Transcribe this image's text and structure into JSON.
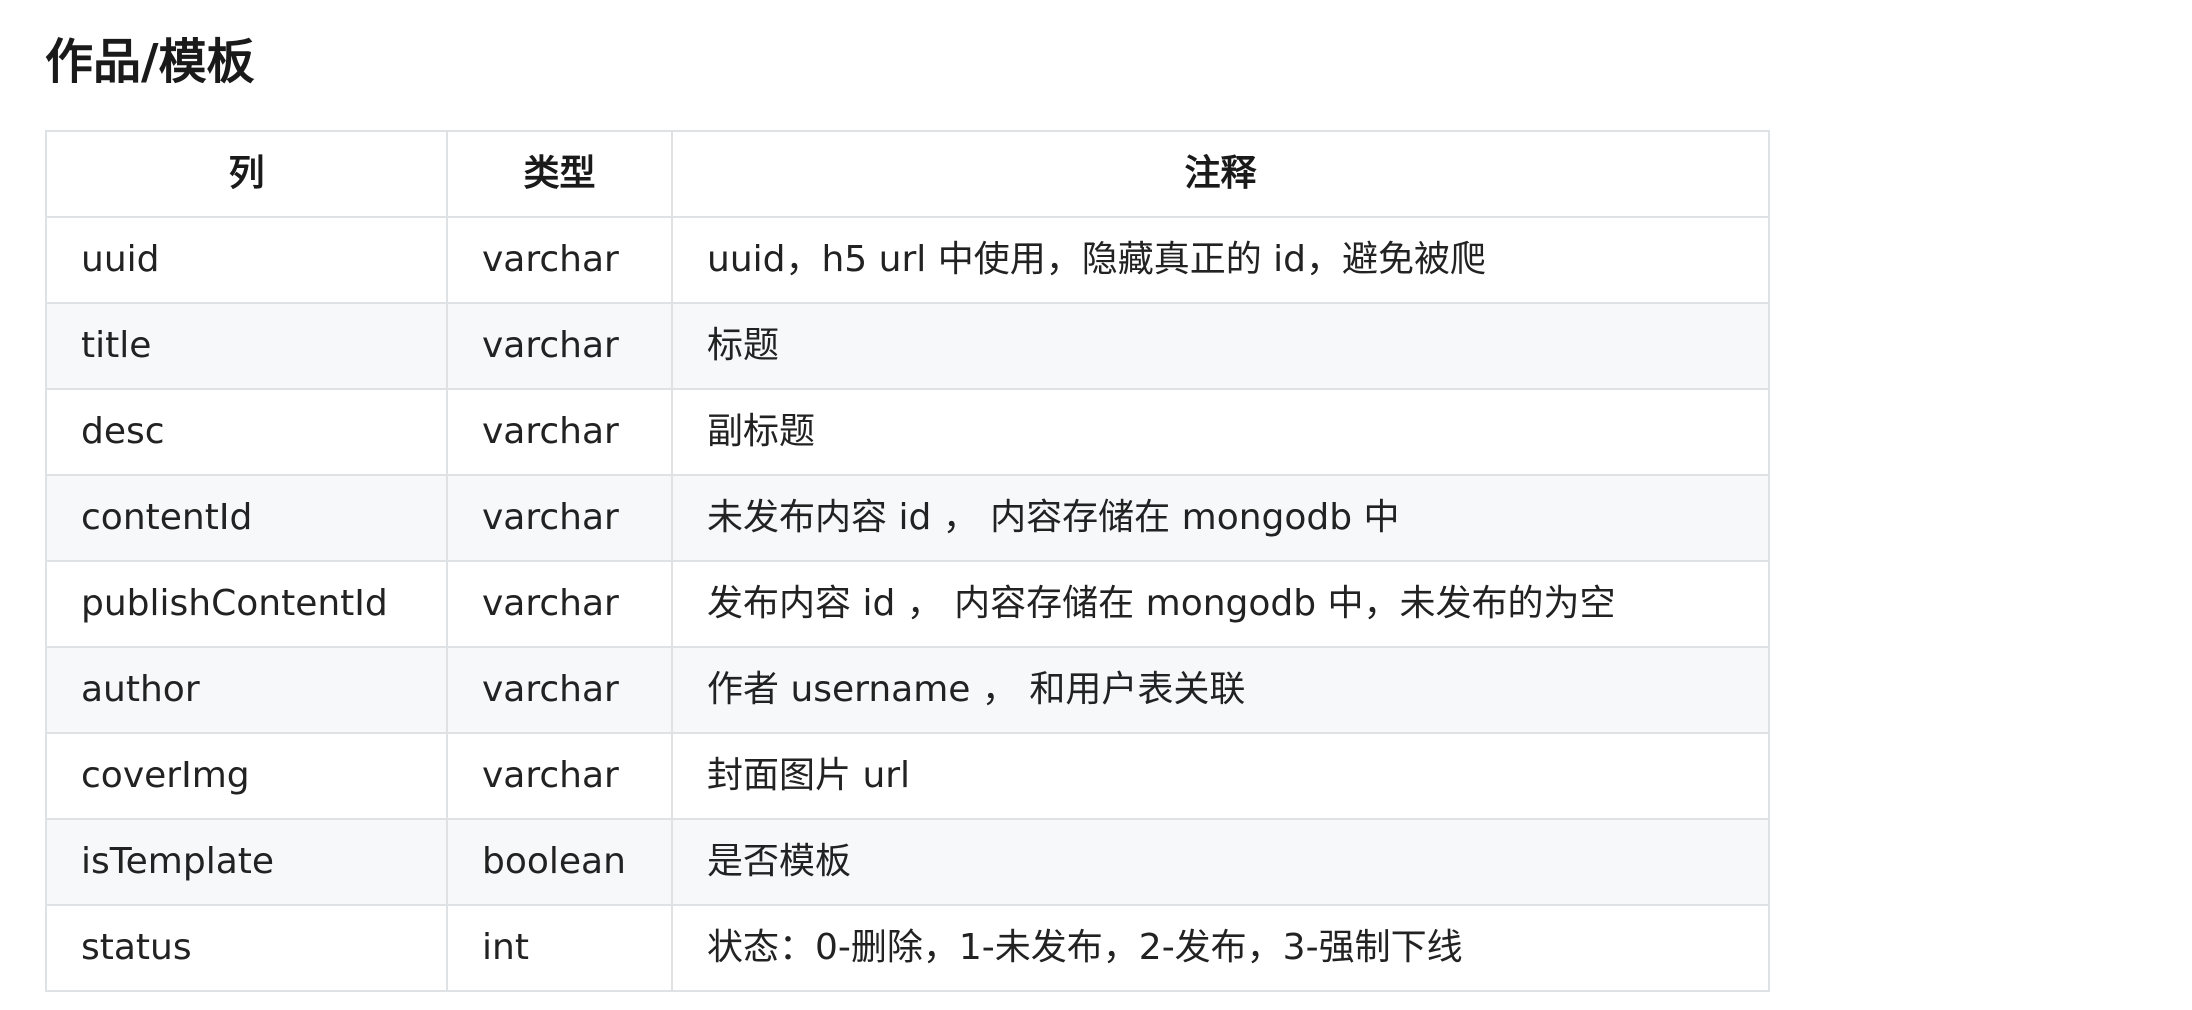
{
  "page": {
    "title": "作品/模板"
  },
  "table": {
    "headers": {
      "column": "列",
      "type": "类型",
      "comment": "注释"
    },
    "rows": [
      {
        "column": "uuid",
        "type": "varchar",
        "comment": "uuid，h5 url 中使用，隐藏真正的 id，避免被爬"
      },
      {
        "column": "title",
        "type": "varchar",
        "comment": "标题"
      },
      {
        "column": "desc",
        "type": "varchar",
        "comment": "副标题"
      },
      {
        "column": "contentId",
        "type": "varchar",
        "comment": "未发布内容 id ， 内容存储在 mongodb 中"
      },
      {
        "column": "publishContentId",
        "type": "varchar",
        "comment": "发布内容 id ， 内容存储在 mongodb 中，未发布的为空"
      },
      {
        "column": "author",
        "type": "varchar",
        "comment": "作者 username ， 和用户表关联"
      },
      {
        "column": "coverImg",
        "type": "varchar",
        "comment": "封面图片 url"
      },
      {
        "column": "isTemplate",
        "type": "boolean",
        "comment": "是否模板"
      },
      {
        "column": "status",
        "type": "int",
        "comment": "状态：0-删除，1-未发布，2-发布，3-强制下线"
      }
    ]
  },
  "colors": {
    "border": "#dfe2e5",
    "stripe": "#f6f8fa",
    "text": "#222222"
  }
}
